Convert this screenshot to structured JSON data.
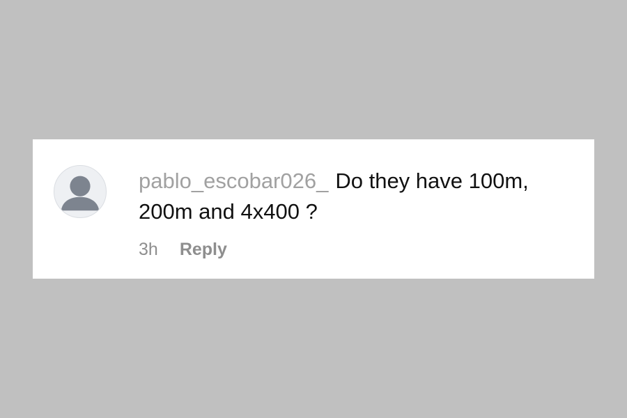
{
  "comment": {
    "username": "pablo_escobar026_",
    "text": "Do they have 100m, 200m and 4x400 ?",
    "timestamp": "3h",
    "reply_label": "Reply",
    "avatar_icon": "default-user-avatar-icon"
  },
  "colors": {
    "page_background": "#c0c0c0",
    "card_background": "#ffffff",
    "username": "#a1a1a1",
    "text": "#111111",
    "meta": "#8e8e8e",
    "avatar_bg": "#eef0f3",
    "avatar_figure": "#7d848f"
  }
}
